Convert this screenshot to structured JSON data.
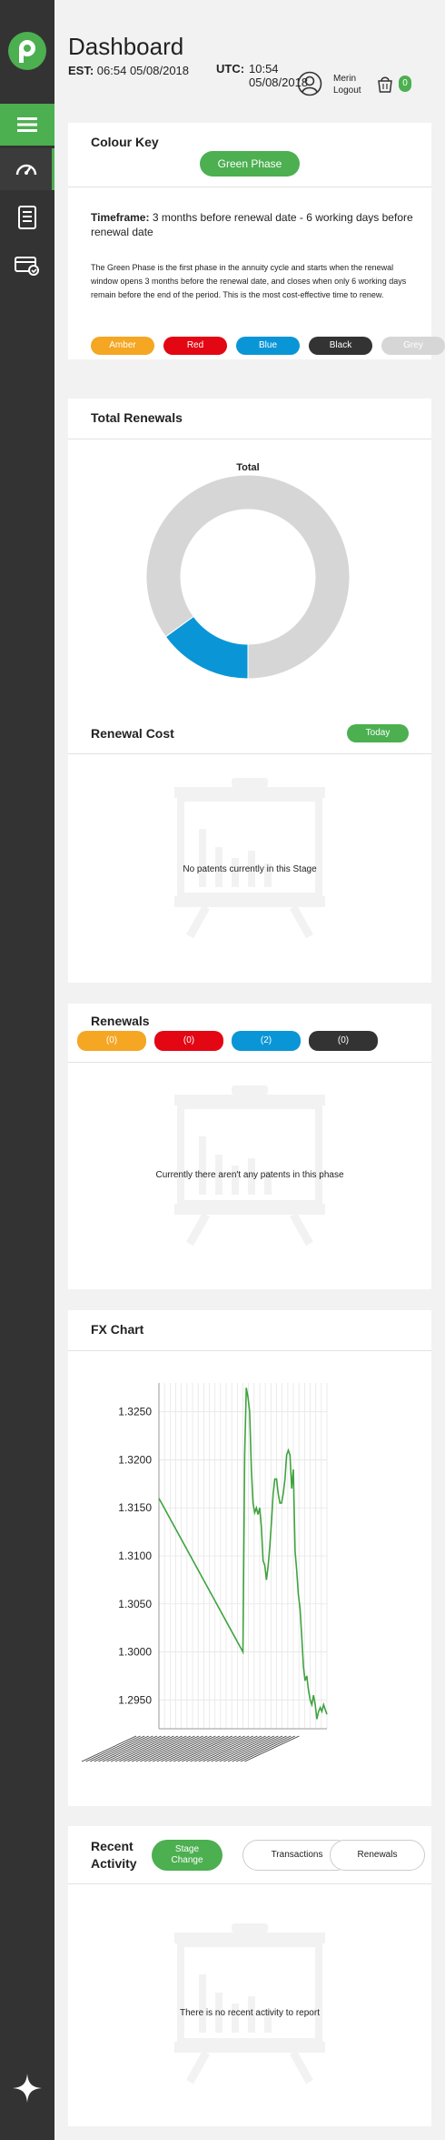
{
  "header": {
    "title": "Dashboard",
    "est_label": "EST:",
    "est_value": "06:54 05/08/2018",
    "utc_label": "UTC:",
    "utc_value": "10:54 05/08/2018",
    "user_name": "Merin",
    "logout": "Logout",
    "cart_count": "0"
  },
  "colour_key": {
    "title": "Colour Key",
    "phase_button": "Green Phase",
    "timeframe_label": "Timeframe:",
    "timeframe_value": "3 months before renewal date - 6 working days before renewal date",
    "description": "The Green Phase is the first phase in the annuity cycle and starts when the renewal window opens 3 months before the renewal date, and closes when only 6 working days remain before the end of the period. This is the most cost-effective time to renew.",
    "phases": [
      {
        "label": "Amber",
        "color": "#f5a623"
      },
      {
        "label": "Red",
        "color": "#e30613"
      },
      {
        "label": "Blue",
        "color": "#0a96d6"
      },
      {
        "label": "Black",
        "color": "#333333"
      },
      {
        "label": "Grey",
        "color": "#d6d6d6"
      }
    ]
  },
  "total_renewals": {
    "title": "Total Renewals",
    "chart_title": "Total"
  },
  "renewal_cost": {
    "title": "Renewal Cost",
    "today_button": "Today",
    "empty_message": "No patents currently in this Stage"
  },
  "renewals": {
    "title": "Renewals",
    "counts": [
      {
        "label": "(0)",
        "color": "#f5a623"
      },
      {
        "label": "(0)",
        "color": "#e30613"
      },
      {
        "label": "(2)",
        "color": "#0a96d6"
      },
      {
        "label": "(0)",
        "color": "#333333"
      }
    ],
    "empty_message": "Currently there aren't any patents in this phase"
  },
  "fx_chart": {
    "title": "FX Chart"
  },
  "recent_activity": {
    "title_line1": "Recent",
    "title_line2": "Activity",
    "tab_stage_line1": "Stage",
    "tab_stage_line2": "Change",
    "tab_transactions": "Transactions",
    "tab_renewals": "Renewals",
    "empty_message": "There is no recent activity to report"
  },
  "chart_data": [
    {
      "type": "pie",
      "title": "Total",
      "categories": [
        "Blue",
        "Grey"
      ],
      "values": [
        0.15,
        0.85
      ],
      "colors": [
        "#0a96d6",
        "#d6d6d6"
      ],
      "donut": true
    },
    {
      "type": "line",
      "title": "",
      "ylim": [
        1.292,
        1.328
      ],
      "yticks": [
        1.295,
        1.3,
        1.305,
        1.31,
        1.315,
        1.32,
        1.325
      ],
      "ytick_labels": [
        "1.2950",
        "1.3000",
        "1.3050",
        "1.3100",
        "1.3150",
        "1.3200",
        "1.3250"
      ],
      "grid": true,
      "series": [
        {
          "color": "#3fa33f",
          "x": [
            0,
            0.5,
            0.51,
            0.52,
            0.53,
            0.54,
            0.55,
            0.56,
            0.57,
            0.58,
            0.59,
            0.6,
            0.61,
            0.62,
            0.63,
            0.64,
            0.65,
            0.66,
            0.67,
            0.68,
            0.69,
            0.7,
            0.71,
            0.72,
            0.73,
            0.74,
            0.75,
            0.76,
            0.77,
            0.78,
            0.79,
            0.8,
            0.81,
            0.82,
            0.83,
            0.84,
            0.85,
            0.86,
            0.87,
            0.88,
            0.89,
            0.9,
            0.91,
            0.92,
            0.93,
            0.94,
            0.95,
            0.96,
            0.97,
            0.98,
            0.99,
            1.0
          ],
          "y": [
            1.316,
            1.3,
            1.3205,
            1.3275,
            1.3265,
            1.325,
            1.319,
            1.3155,
            1.3145,
            1.315,
            1.3143,
            1.315,
            1.313,
            1.3095,
            1.309,
            1.3075,
            1.309,
            1.311,
            1.3135,
            1.3165,
            1.318,
            1.318,
            1.3165,
            1.3155,
            1.3155,
            1.3165,
            1.318,
            1.3205,
            1.321,
            1.3205,
            1.317,
            1.319,
            1.3105,
            1.3085,
            1.306,
            1.3045,
            1.3015,
            1.2985,
            1.297,
            1.2975,
            1.296,
            1.295,
            1.2945,
            1.2955,
            1.2945,
            1.293,
            1.2938,
            1.2942,
            1.2938,
            1.2945,
            1.294,
            1.2935
          ]
        }
      ]
    }
  ]
}
